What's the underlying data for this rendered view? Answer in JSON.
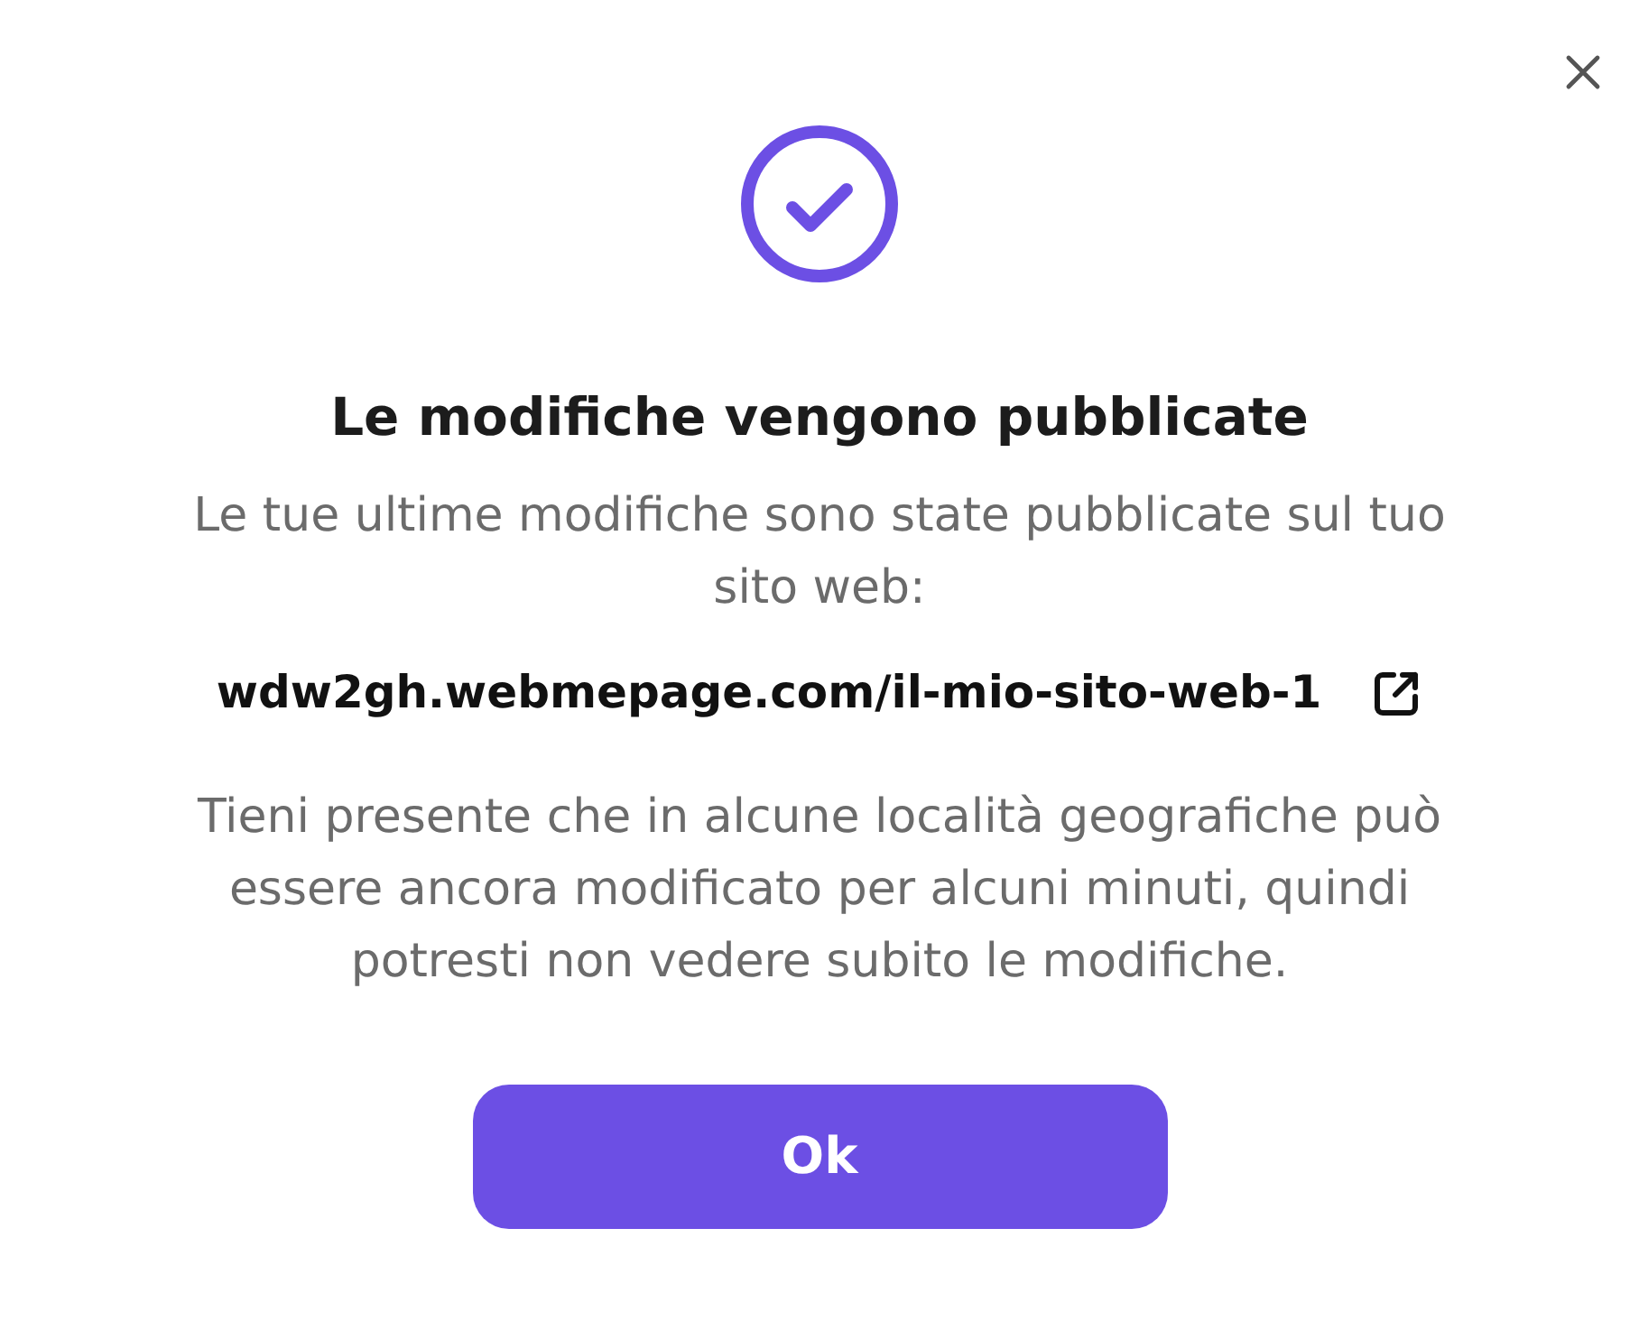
{
  "dialog": {
    "title": "Le modifiche vengono pubblicate",
    "message": "Le tue ultime modifiche sono state pubblicate sul tuo sito web:",
    "link": "wdw2gh.webmepage.com/il-mio-sito-web-1",
    "note": "Tieni presente che in alcune località geografiche può essere ancora modificato per alcuni minuti, quindi potresti non vedere subito le modifiche.",
    "buttons": [
      {
        "label": "Ok"
      }
    ]
  }
}
